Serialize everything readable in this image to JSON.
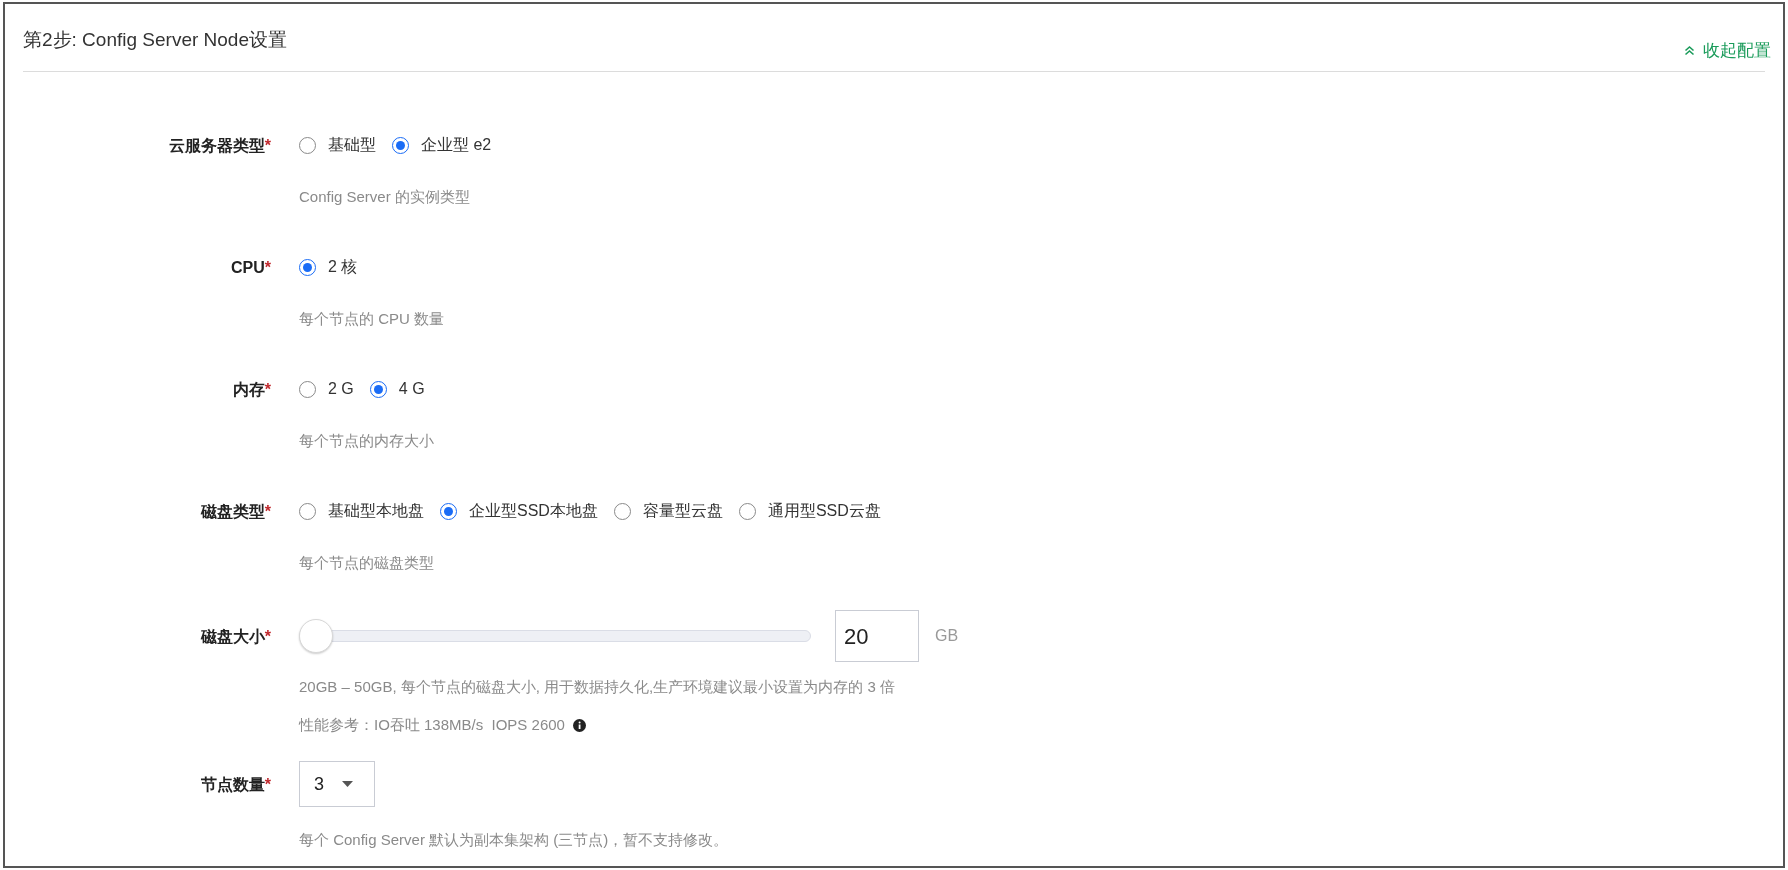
{
  "header": {
    "title": "第2步: Config Server Node设置",
    "collapse_link": "收起配置"
  },
  "fields": [
    {
      "kind": "radio",
      "label": "云服务器类型",
      "required_mark": "*",
      "options": [
        {
          "label": "基础型",
          "selected": false
        },
        {
          "label": "企业型 e2",
          "selected": true
        }
      ],
      "hints": [
        "Config Server 的实例类型"
      ]
    },
    {
      "kind": "radio",
      "label": "CPU",
      "required_mark": "*",
      "options": [
        {
          "label": "2 核",
          "selected": true
        }
      ],
      "hints": [
        "每个节点的 CPU 数量"
      ]
    },
    {
      "kind": "radio",
      "label": "内存",
      "required_mark": "*",
      "options": [
        {
          "label": "2 G",
          "selected": false
        },
        {
          "label": "4 G",
          "selected": true
        }
      ],
      "hints": [
        "每个节点的内存大小"
      ]
    },
    {
      "kind": "radio",
      "label": "磁盘类型",
      "required_mark": "*",
      "options": [
        {
          "label": "基础型本地盘",
          "selected": false
        },
        {
          "label": "企业型SSD本地盘",
          "selected": true
        },
        {
          "label": "容量型云盘",
          "selected": false
        },
        {
          "label": "通用型SSD云盘",
          "selected": false
        }
      ],
      "hints": [
        "每个节点的磁盘类型"
      ]
    },
    {
      "kind": "slider",
      "label": "磁盘大小",
      "required_mark": "*",
      "level": 0,
      "value": "20",
      "unit": "GB",
      "hints": [
        "20GB – 50GB, 每个节点的磁盘大小, 用于数据持久化,生产环境建议最小设置为内存的 3 倍"
      ],
      "note": {
        "text": "性能参考：IO吞吐 138MB/s  IOPS 2600"
      }
    },
    {
      "kind": "select",
      "label": "节点数量",
      "required_mark": "*",
      "value": "3",
      "hints": [
        "每个 Config Server 默认为副本集架构 (三节点)，暂不支持修改。"
      ]
    }
  ]
}
